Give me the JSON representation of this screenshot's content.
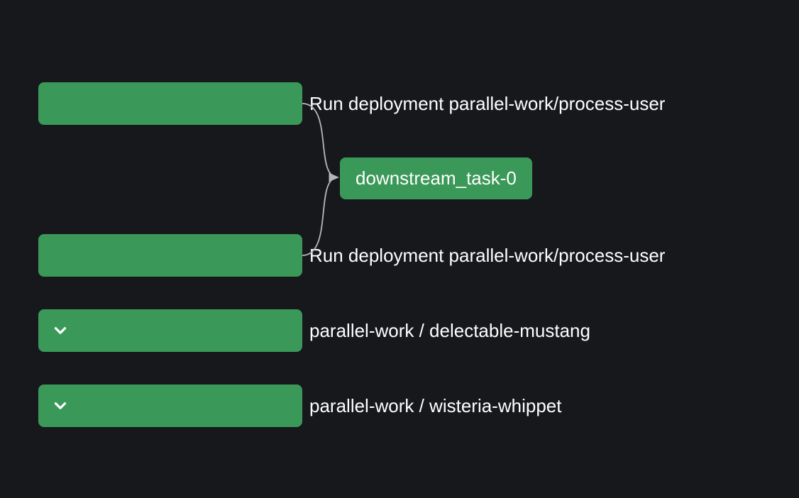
{
  "tasks": [
    {
      "label": "Run deployment parallel-work/process-user",
      "expandable": false
    },
    {
      "label": "Run deployment parallel-work/process-user",
      "expandable": false
    },
    {
      "label": "parallel-work / delectable-mustang",
      "expandable": true
    },
    {
      "label": "parallel-work / wisteria-whippet",
      "expandable": true
    }
  ],
  "downstream": {
    "label": "downstream_task-0"
  }
}
